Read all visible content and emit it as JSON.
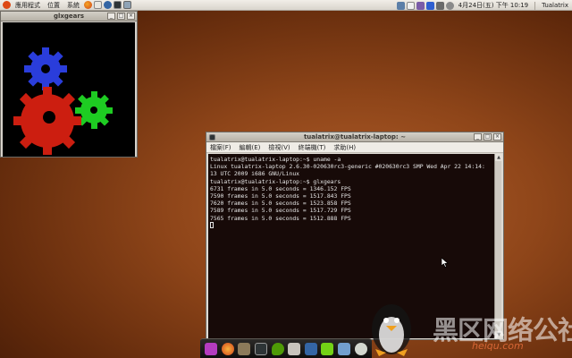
{
  "colors": {
    "panel_bg": "#e6e2dc",
    "terminal_bg": "#170a08",
    "terminal_fg": "#e6e6e6",
    "gear_red": "#cc1e10",
    "gear_green": "#1ecc22",
    "gear_blue": "#2a3ddb"
  },
  "top_panel": {
    "menus": [
      "應用程式",
      "位置",
      "系統"
    ],
    "launcher_icons": [
      "ubuntu-logo-icon",
      "firefox-icon",
      "mail-icon",
      "help-icon",
      "terminal-icon",
      "monitor-icon"
    ],
    "tray_icons": [
      "network-icon",
      "mail-indicator-icon",
      "user-icon",
      "bluetooth-icon",
      "battery-icon",
      "volume-icon"
    ],
    "clock": "4月24日(五) 下午 10:19",
    "user": "Tualatrix"
  },
  "glxgears_window": {
    "title": "glxgears",
    "buttons": [
      "_",
      "□",
      "×"
    ]
  },
  "terminal_window": {
    "title": "tualatrix@tualatrix-laptop: ~",
    "menus": [
      "檔案(F)",
      "編輯(E)",
      "檢視(V)",
      "終端機(T)",
      "求助(H)"
    ],
    "lines": [
      "tualatrix@tualatrix-laptop:~$ uname -a",
      "Linux tualatrix-laptop 2.6.30-020630rc3-generic #020630rc3 SMP Wed Apr 22 14:14:",
      "13 UTC 2009 i686 GNU/Linux",
      "tualatrix@tualatrix-laptop:~$ glxgears",
      "6731 frames in 5.0 seconds = 1346.152 FPS",
      "7590 frames in 5.0 seconds = 1517.843 FPS",
      "7620 frames in 5.0 seconds = 1523.858 FPS",
      "7589 frames in 5.0 seconds = 1517.729 FPS",
      "7565 frames in 5.0 seconds = 1512.888 FPS"
    ]
  },
  "dock": {
    "icons": [
      "system-icon",
      "firefox-icon",
      "gimp-icon",
      "terminal-icon",
      "pidgin-icon",
      "gaming-icon",
      "rhythmbox-icon",
      "xchat-icon",
      "desktop-icon",
      "clock-icon"
    ]
  },
  "watermark": {
    "text": "黑区网络公社",
    "url": "heiqu.com"
  }
}
